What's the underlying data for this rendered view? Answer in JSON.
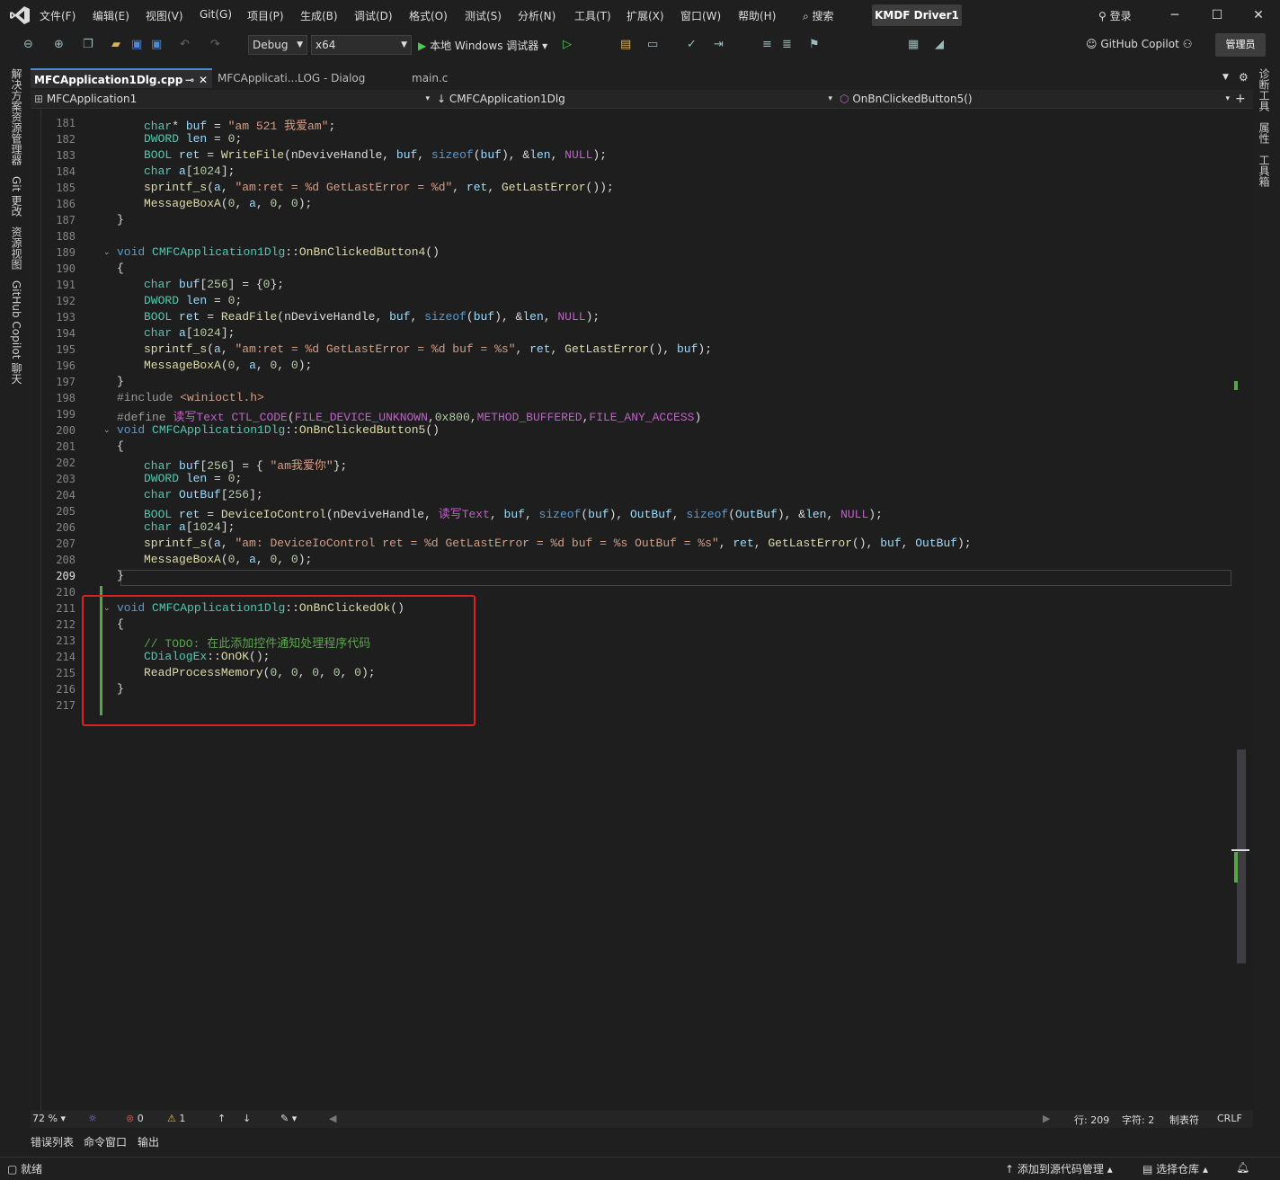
{
  "menu": [
    "文件(F)",
    "编辑(E)",
    "视图(V)",
    "Git(G)",
    "项目(P)",
    "生成(B)",
    "调试(D)",
    "格式(O)",
    "测试(S)",
    "分析(N)",
    "工具(T)",
    "扩展(X)",
    "窗口(W)",
    "帮助(H)"
  ],
  "search_label": "搜索",
  "solution_name": "KMDF Driver1",
  "login_label": "登录",
  "toolbar": {
    "config": "Debug",
    "platform": "x64",
    "run_label": "本地 Windows 调试器",
    "copilot_label": "GitHub Copilot",
    "admin_label": "管理员"
  },
  "left_rail": [
    "解决方案资源管理器",
    "Git 更改",
    "资源视图",
    "GitHub Copilot 聊天"
  ],
  "right_rail": [
    "诊断工具",
    "属性",
    "工具箱"
  ],
  "tabs": [
    {
      "label": "MFCApplication1Dlg.cpp",
      "active": true
    },
    {
      "label": "MFCApplicati...LOG - Dialog",
      "active": false
    },
    {
      "label": "main.c",
      "active": false
    }
  ],
  "nav": {
    "project": "MFCApplication1",
    "class": "CMFCApplication1Dlg",
    "member": "OnBnClickedButton5()"
  },
  "lines": [
    {
      "n": "181",
      "html": "<span class='ty'>char</span>* <span class='va'>buf</span> = <span class='st'>\"am 521 我爱am\"</span>;"
    },
    {
      "n": "182",
      "html": "<span class='ty'>DWORD</span> <span class='va'>len</span> = <span class='nm'>0</span>;"
    },
    {
      "n": "183",
      "html": "<span class='ty'>BOOL</span> <span class='va'>ret</span> = <span class='fn'>WriteFile</span>(nDeviveHandle, <span class='va'>buf</span>, <span class='kw'>sizeof</span>(<span class='va'>buf</span>), &amp;<span class='va'>len</span>, <span class='mc'>NULL</span>);"
    },
    {
      "n": "184",
      "html": "<span class='ty'>char</span> <span class='va'>a</span>[<span class='nm'>1024</span>];"
    },
    {
      "n": "185",
      "html": "<span class='fn'>sprintf_s</span>(<span class='va'>a</span>, <span class='st'>\"am:ret = %d GetLastError = %d\"</span>, <span class='va'>ret</span>, <span class='fn'>GetLastError</span>());"
    },
    {
      "n": "186",
      "html": "<span class='fn'>MessageBoxA</span>(<span class='nm'>0</span>, <span class='va'>a</span>, <span class='nm'>0</span>, <span class='nm'>0</span>);"
    },
    {
      "n": "187",
      "html": "}"
    },
    {
      "n": "188",
      "html": ""
    },
    {
      "n": "189",
      "html": "<span class='kw'>void</span> <span class='ty'>CMFCApplication1Dlg</span>::<span class='fn'>OnBnClickedButton4</span>()"
    },
    {
      "n": "190",
      "html": "{"
    },
    {
      "n": "191",
      "html": "<span class='ty'>char</span> <span class='va'>buf</span>[<span class='nm'>256</span>] = {<span class='nm'>0</span>};"
    },
    {
      "n": "192",
      "html": "<span class='ty'>DWORD</span> <span class='va'>len</span> = <span class='nm'>0</span>;"
    },
    {
      "n": "193",
      "html": "<span class='ty'>BOOL</span> <span class='va'>ret</span> = <span class='fn'>ReadFile</span>(nDeviveHandle, <span class='va'>buf</span>, <span class='kw'>sizeof</span>(<span class='va'>buf</span>), &amp;<span class='va'>len</span>, <span class='mc'>NULL</span>);"
    },
    {
      "n": "194",
      "html": "<span class='ty'>char</span> <span class='va'>a</span>[<span class='nm'>1024</span>];"
    },
    {
      "n": "195",
      "html": "<span class='fn'>sprintf_s</span>(<span class='va'>a</span>, <span class='st'>\"am:ret = %d GetLastError = %d buf = %s\"</span>, <span class='va'>ret</span>, <span class='fn'>GetLastError</span>(), <span class='va'>buf</span>);"
    },
    {
      "n": "196",
      "html": "<span class='fn'>MessageBoxA</span>(<span class='nm'>0</span>, <span class='va'>a</span>, <span class='nm'>0</span>, <span class='nm'>0</span>);"
    },
    {
      "n": "197",
      "html": "}"
    },
    {
      "n": "198",
      "html": "<span class='pp'>#include</span> <span class='st'>&lt;winioctl.h&gt;</span>"
    },
    {
      "n": "199",
      "html": "<span class='pp'>#define</span> <span class='mc'>读写Text</span> <span class='mc'>CTL_CODE</span>(<span class='mc'>FILE_DEVICE_UNKNOWN</span>,<span class='nm'>0x800</span>,<span class='mc'>METHOD_BUFFERED</span>,<span class='mc'>FILE_ANY_ACCESS</span>)"
    },
    {
      "n": "200",
      "html": "<span class='kw'>void</span> <span class='ty'>CMFCApplication1Dlg</span>::<span class='fn'>OnBnClickedButton5</span>()"
    },
    {
      "n": "201",
      "html": "{"
    },
    {
      "n": "202",
      "html": "<span class='ty'>char</span> <span class='va'>buf</span>[<span class='nm'>256</span>] = { <span class='st'>\"am我爱你\"</span>};"
    },
    {
      "n": "203",
      "html": "<span class='ty'>DWORD</span> <span class='va'>len</span> = <span class='nm'>0</span>;"
    },
    {
      "n": "204",
      "html": "<span class='ty'>char</span> <span class='va'>OutBuf</span>[<span class='nm'>256</span>];"
    },
    {
      "n": "205",
      "html": "<span class='ty'>BOOL</span> <span class='va'>ret</span> = <span class='fn'>DeviceIoControl</span>(nDeviveHandle, <span class='mc'>读写Text</span>, <span class='va'>buf</span>, <span class='kw'>sizeof</span>(<span class='va'>buf</span>), <span class='va'>OutBuf</span>, <span class='kw'>sizeof</span>(<span class='va'>OutBuf</span>), &amp;<span class='va'>len</span>, <span class='mc'>NULL</span>);"
    },
    {
      "n": "206",
      "html": "<span class='ty'>char</span> <span class='va'>a</span>[<span class='nm'>1024</span>];"
    },
    {
      "n": "207",
      "html": "<span class='fn'>sprintf_s</span>(<span class='va'>a</span>, <span class='st'>\"am: DeviceIoControl ret = %d GetLastError = %d buf = %s OutBuf = %s\"</span>, <span class='va'>ret</span>, <span class='fn'>GetLastError</span>(), <span class='va'>buf</span>, <span class='va'>OutBuf</span>);"
    },
    {
      "n": "208",
      "html": "<span class='fn'>MessageBoxA</span>(<span class='nm'>0</span>, <span class='va'>a</span>, <span class='nm'>0</span>, <span class='nm'>0</span>);"
    },
    {
      "n": "209",
      "html": "}"
    },
    {
      "n": "210",
      "html": ""
    },
    {
      "n": "211",
      "html": "<span class='kw'>void</span> <span class='ty'>CMFCApplication1Dlg</span>::<span class='fn'>OnBnClickedOk</span>()"
    },
    {
      "n": "212",
      "html": "{"
    },
    {
      "n": "213",
      "html": "<span class='cm'>// TODO: 在此添加控件通知处理程序代码</span>"
    },
    {
      "n": "214",
      "html": "<span class='ty'>CDialogEx</span>::<span class='fn'>OnOK</span>();"
    },
    {
      "n": "215",
      "html": "<span class='fn'>ReadProcessMemory</span>(<span class='nm'>0</span>, <span class='nm'>0</span>, <span class='nm'>0</span>, <span class='nm'>0</span>, <span class='nm'>0</span>);"
    },
    {
      "n": "216",
      "html": "}"
    },
    {
      "n": "217",
      "html": ""
    }
  ],
  "status_strip": {
    "zoom": "72 %",
    "errors": "0",
    "warnings": "1",
    "line": "行: 209",
    "col": "字符: 2",
    "tabs": "制表符",
    "eol": "CRLF"
  },
  "bottom_tabs": [
    "错误列表",
    "命令窗口",
    "输出"
  ],
  "statusbar": {
    "ready": "就绪",
    "add_source": "添加到源代码管理",
    "select_repo": "选择仓库"
  }
}
